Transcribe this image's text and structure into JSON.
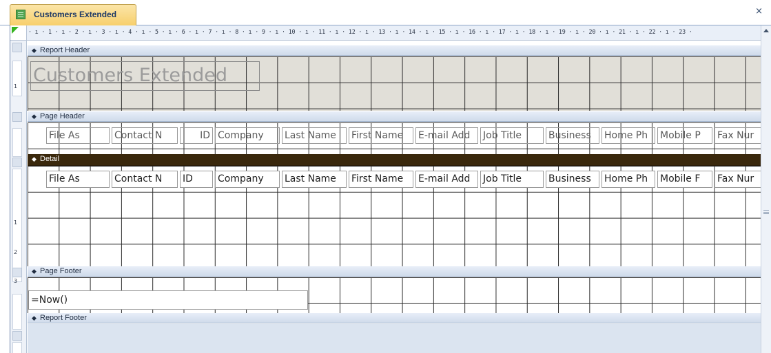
{
  "document": {
    "tab_title": "Customers Extended",
    "tab_icon": "report-icon",
    "close_label": "×"
  },
  "ruler": {
    "horizontal_text": "· ı · 1 · ı · 2 · ı · 3 · ı · 4 · ı · 5 · ı · 6 · ı · 7 · ı · 8 · ı · 9 · ı · 10 · ı · 11 · ı · 12 · ı · 13 · ı · 14 · ı · 15 · ı · 16 · ı · 17 · ı · 18 · ı · 19 · ı · 20 · ı · 21 · ı · 22 · ı · 23 ·",
    "vertical_numbers": [
      "1",
      "1",
      "2",
      "3"
    ]
  },
  "sections": {
    "report_header": "Report Header",
    "page_header": "Page Header",
    "detail": "Detail",
    "page_footer": "Page Footer",
    "report_footer": "Report Footer"
  },
  "report_title": "Customers Extended",
  "page_header_labels": [
    "File As",
    "Contact N",
    "ID",
    "Company",
    "Last Name",
    "First Name",
    "E-mail Add",
    "Job Title",
    "Business",
    "Home Ph",
    "Mobile P",
    "Fax Nur"
  ],
  "detail_fields": [
    "File As",
    "Contact N",
    "ID",
    "Company",
    "Last Name",
    "First Name",
    "E-mail Add",
    "Job Title",
    "Business",
    "Home Ph",
    "Mobile F",
    "Fax Nur"
  ],
  "page_footer_expression": "=Now()",
  "colors": {
    "tab_gradient": "#f7cf6c",
    "detail_bar": "#3a280c",
    "report_header_band": "#e1dfd8",
    "ruler_start": "#35b31f"
  }
}
